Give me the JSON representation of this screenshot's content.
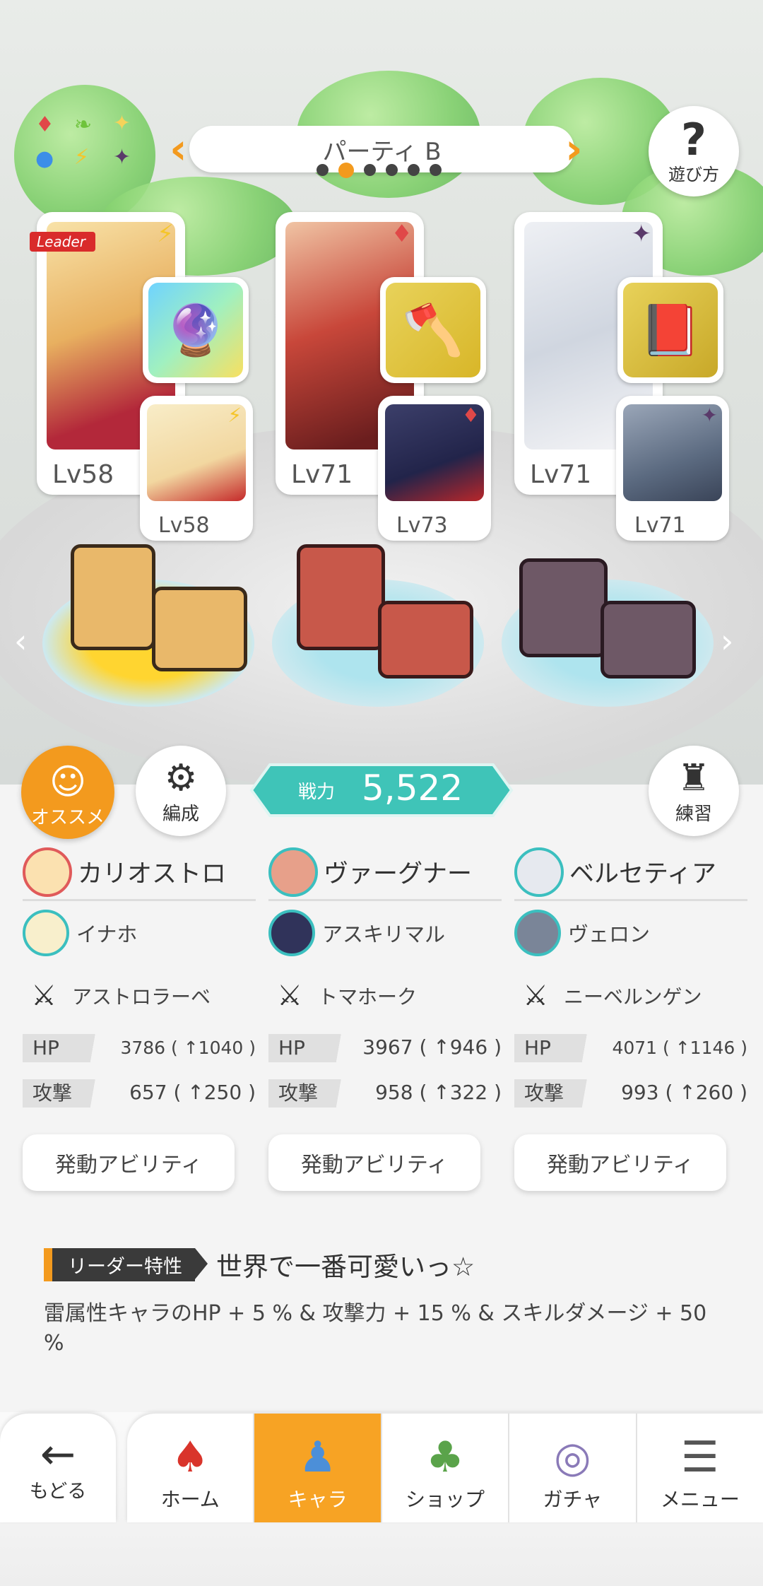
{
  "header": {
    "party_name": "パーティ B",
    "help_label": "遊び方",
    "party_dots": 6,
    "active_dot": 1
  },
  "team": {
    "slots": [
      {
        "leader_tag": "Leader",
        "main_level": "Lv58",
        "sub_level": "Lv58",
        "element": "lightning",
        "sub_element": "lightning"
      },
      {
        "main_level": "Lv71",
        "sub_level": "Lv73",
        "element": "fire",
        "sub_element": "fire"
      },
      {
        "main_level": "Lv71",
        "sub_level": "Lv71",
        "element": "dark",
        "sub_element": "dark"
      }
    ]
  },
  "actions": {
    "recommend_label": "オススメ",
    "formation_label": "編成",
    "practice_label": "練習",
    "power_label": "戦力",
    "power_value": "5,522"
  },
  "characters": [
    {
      "main": "カリオストロ",
      "sub": "イナホ",
      "weapon": "アストロラーベ",
      "hp_label": "HP",
      "hp": "3786 ( ↑1040 )",
      "atk_label": "攻撃",
      "atk": "657 ( ↑250 )",
      "ability": "発動アビリティ"
    },
    {
      "main": "ヴァーグナー",
      "sub": "アスキリマル",
      "weapon": "トマホーク",
      "hp_label": "HP",
      "hp": "3967 ( ↑946 )",
      "atk_label": "攻撃",
      "atk": "958 ( ↑322 )",
      "ability": "発動アビリティ"
    },
    {
      "main": "ベルセティア",
      "sub": "ヴェロン",
      "weapon": "ニーベルンゲン",
      "hp_label": "HP",
      "hp": "4071 ( ↑1146 )",
      "atk_label": "攻撃",
      "atk": "993 ( ↑260 )",
      "ability": "発動アビリティ"
    }
  ],
  "leader_skill": {
    "tag": "リーダー特性",
    "title": "世界で一番可愛いっ☆",
    "description": "雷属性キャラのHP + 5 % & 攻撃力 + 15 % & スキルダメージ + 50 %"
  },
  "nav": {
    "back": "もどる",
    "tabs": [
      "ホーム",
      "キャラ",
      "ショップ",
      "ガチャ",
      "メニュー"
    ],
    "active_tab": "キャラ"
  },
  "colors": {
    "accent": "#f39a1e",
    "power_badge": "#3fc4b8",
    "active_tab": "#f7a324"
  }
}
